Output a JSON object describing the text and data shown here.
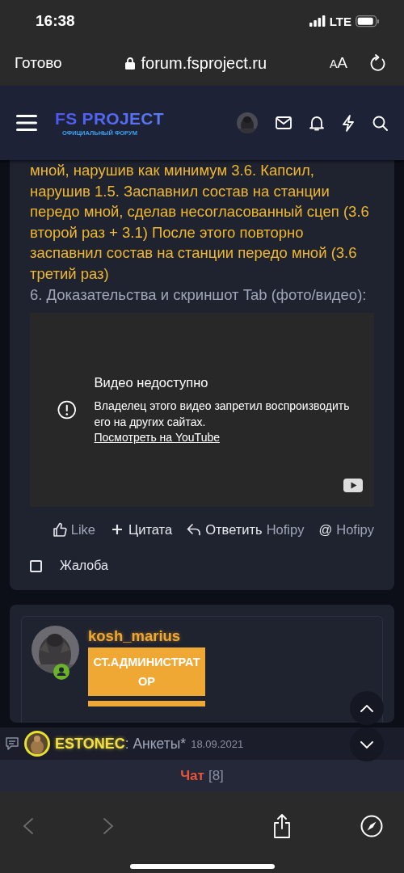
{
  "status_bar": {
    "time": "16:38",
    "network": "LTE"
  },
  "address_bar": {
    "done": "Готово",
    "url": "forum.fsproject.ru",
    "text_size": "AA"
  },
  "site_header": {
    "logo_title": "FS PROJECT",
    "logo_subtitle": "ОФИЦИАЛЬНЫЙ ФОРУМ"
  },
  "post": {
    "text": "мной, нарушив как минимум 3.6. Капсил, нарушив 1.5. Заспавнил состав на станции передо мной, сделав несогласованный сцеп (3.6 второй раз + 3.1) После этого повторно заспавнил состав на станции передо мной (3.6 третий раз)",
    "evidence_label": "6. Доказательства и скриншот Tab (фото/видео):",
    "video": {
      "title": "Видео недоступно",
      "message": "Владелец этого видео запретил воспроизводить его на других сайтах.",
      "link": "Посмотреть на YouTube"
    },
    "actions": [
      {
        "kind": "like",
        "label": "Like"
      },
      {
        "kind": "quote",
        "label": "Цитата"
      },
      {
        "kind": "reply",
        "label": "Ответить",
        "detail": "Hofipy"
      },
      {
        "kind": "mention",
        "symbol": "@",
        "label": "Hofipy"
      }
    ],
    "report": {
      "label": "Жалоба",
      "checked": false
    }
  },
  "next_post": {
    "username": "kosh_marius",
    "role": "СТ.АДМИНИСТРАТОР"
  },
  "chat": {
    "author": "ESTONEC",
    "message": ": Анкеты*",
    "date": "18.09.2021",
    "tab": "Чат",
    "count": "[8]"
  },
  "toolbar": {
    "back_disabled": true,
    "forward_disabled": true
  }
}
